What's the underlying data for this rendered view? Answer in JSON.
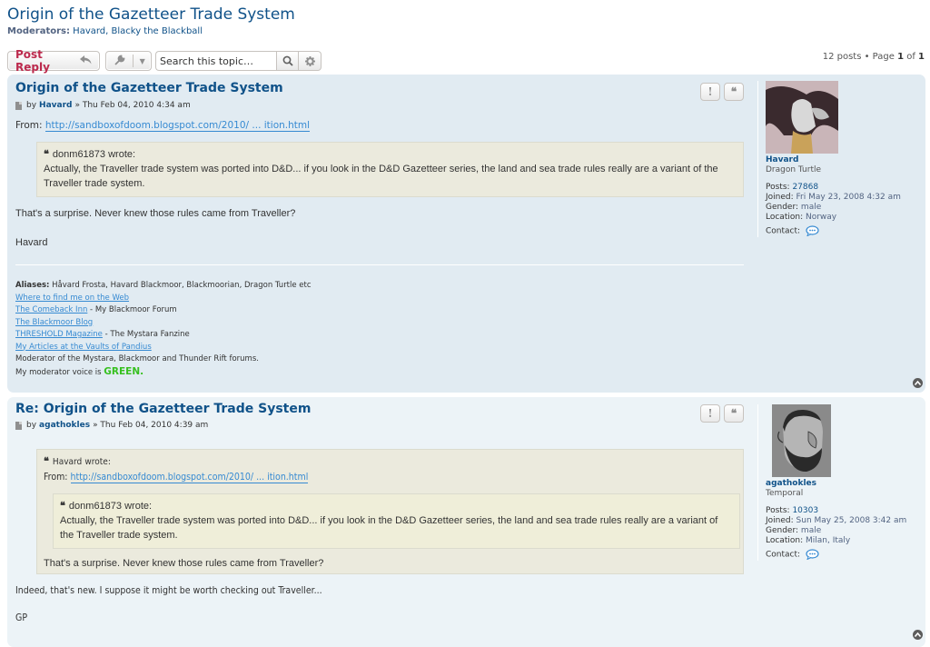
{
  "topic": {
    "title": "Origin of the Gazetteer Trade System",
    "moderators_label": "Moderators:",
    "moderators": "Havard, Blacky the Blackball"
  },
  "action_bar": {
    "post_reply_label": "Post Reply",
    "search_placeholder": "Search this topic…",
    "pagination_prefix": "12 posts • Page ",
    "page_current": "1",
    "page_of": " of ",
    "page_total": "1"
  },
  "posts": [
    {
      "title": "Origin of the Gazetteer Trade System",
      "by": "by",
      "author": "Havard",
      "date": "» Thu Feb 04, 2010 4:34 am",
      "from_label": "From:",
      "from_url": "http://sandboxofdoom.blogspot.com/2010/ ... ition.html",
      "quote": {
        "author": "donm61873",
        "wrote": "wrote:",
        "text": "Actually, the Traveller trade system was ported into D&D... if you look in the D&D Gazetteer series, the land and sea trade rules really are a variant of the Traveller trade system."
      },
      "body_lines": [
        "That's a surprise. Never knew those rules came from Traveller?",
        "Havard"
      ],
      "signature": {
        "aliases_label": "Aliases:",
        "aliases": "Håvard Frosta, Havard Blackmoor, Blackmoorian, Dragon Turtle etc",
        "links": [
          {
            "text": "Where to find me on the Web",
            "suffix": ""
          },
          {
            "text": "The Comeback Inn",
            "suffix": " - My Blackmoor Forum"
          },
          {
            "text": "The Blackmoor Blog",
            "suffix": ""
          },
          {
            "text": "THRESHOLD Magazine",
            "suffix": " - The Mystara Fanzine"
          },
          {
            "text": "My Articles at the Vaults of Pandius",
            "suffix": ""
          }
        ],
        "moderator_line": "Moderator of the Mystara, Blackmoor and Thunder Rift forums.",
        "voice_prefix": "My moderator voice is ",
        "voice_word": "GREEN."
      },
      "profile": {
        "name": "Havard",
        "rank": "Dragon Turtle",
        "posts_label": "Posts:",
        "posts": "27868",
        "joined_label": "Joined:",
        "joined": "Fri May 23, 2008 4:32 am",
        "gender_label": "Gender:",
        "gender": "male",
        "location_label": "Location:",
        "location": "Norway",
        "contact_label": "Contact:"
      }
    },
    {
      "title": "Re: Origin of the Gazetteer Trade System",
      "by": "by",
      "author": "agathokles",
      "date": "» Thu Feb 04, 2010 4:39 am",
      "quote": {
        "author": "Havard",
        "wrote": "wrote:",
        "from_label": "From:",
        "from_url": "http://sandboxofdoom.blogspot.com/2010/ ... ition.html",
        "inner_quote": {
          "author": "donm61873",
          "wrote": "wrote:",
          "text": "Actually, the Traveller trade system was ported into D&D... if you look in the D&D Gazetteer series, the land and sea trade rules really are a variant of the Traveller trade system."
        },
        "text": "That's a surprise. Never knew those rules came from Traveller?"
      },
      "body_lines": [
        "Indeed, that's new. I suppose it might be worth checking out Traveller...",
        "GP"
      ],
      "profile": {
        "name": "agathokles",
        "rank": "Temporal",
        "posts_label": "Posts:",
        "posts": "10303",
        "joined_label": "Joined:",
        "joined": "Sun May 25, 2008 3:42 am",
        "gender_label": "Gender:",
        "gender": "male",
        "location_label": "Location:",
        "location": "Milan, Italy",
        "contact_label": "Contact:"
      }
    }
  ],
  "colors": {
    "link": "#105289",
    "post_reply": "#bc2a4d",
    "post_bg_1": "#e1ebf2",
    "post_bg_2": "#ecf3f7",
    "quote_bg": "#ebeadd",
    "voice_green": "#37c020"
  }
}
